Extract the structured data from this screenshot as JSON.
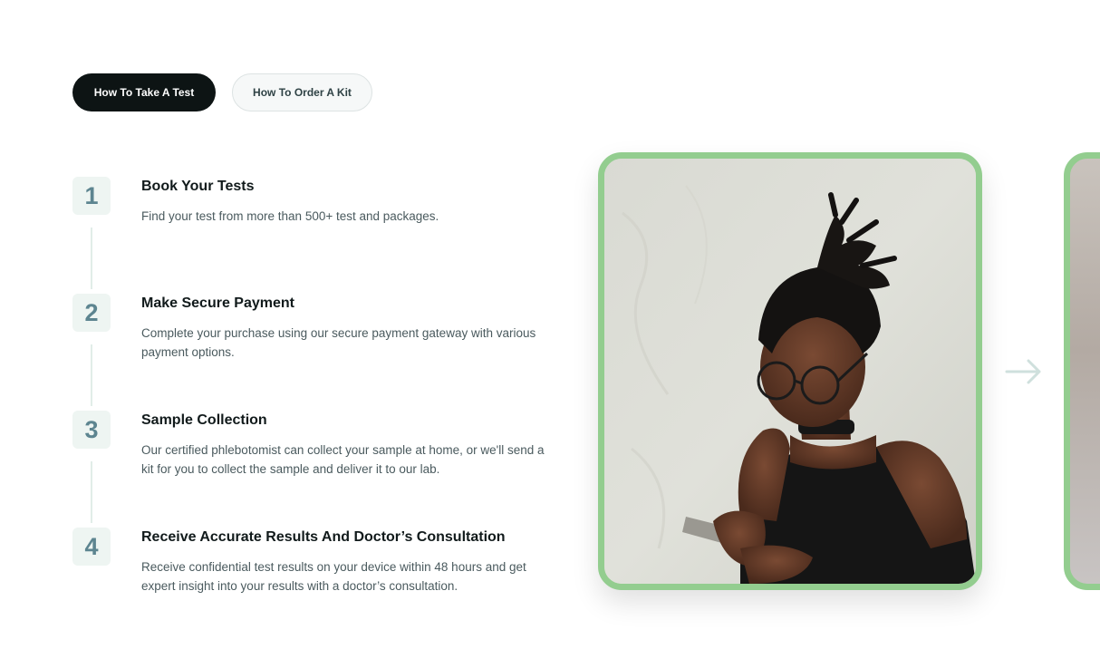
{
  "tabs": [
    {
      "label": "How To Take A Test",
      "active": true
    },
    {
      "label": "How To Order A Kit",
      "active": false
    }
  ],
  "steps": [
    {
      "number": "1",
      "title": "Book Your Tests",
      "description": "Find your test from more than 500+ test and packages."
    },
    {
      "number": "2",
      "title": "Make Secure Payment",
      "description": "Complete your purchase using our secure payment gateway with various payment options."
    },
    {
      "number": "3",
      "title": "Sample Collection",
      "description": "Our certified phlebotomist can collect your sample at home, or we'll send a kit for you to collect the sample and deliver it to our lab."
    },
    {
      "number": "4",
      "title": "Receive Accurate Results And Doctor’s Consultation",
      "description": "Receive confidential test results on your device within 48 hours and get expert insight into your results with a doctor’s consultation."
    }
  ],
  "icons": {
    "next_arrow": "arrow-right-icon"
  },
  "colors": {
    "tab_active_bg": "#0d1414",
    "card_border": "#93cd8f",
    "step_number": "#5d8590",
    "step_number_bg": "#eef5f2"
  }
}
